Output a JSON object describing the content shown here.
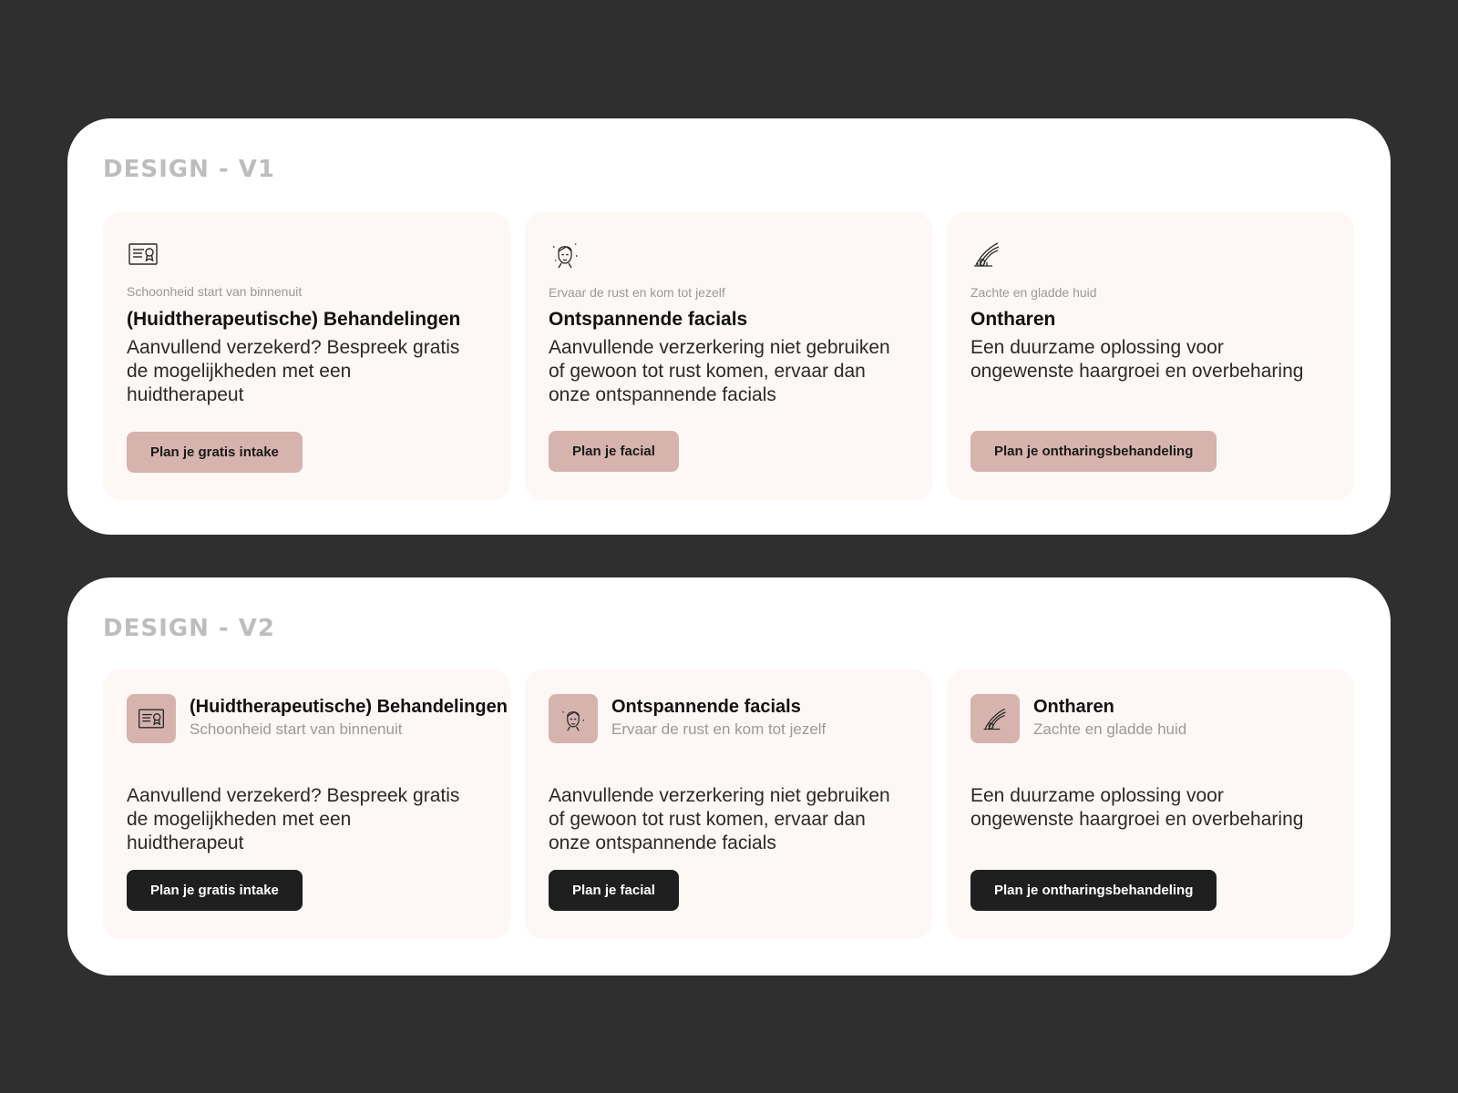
{
  "colors": {
    "background": "#2f2f2f",
    "panel": "#ffffff",
    "card": "#fdf7f5",
    "accent": "#d6b3ad",
    "dark_button": "#1f1f1f",
    "label_gray": "#bdbdbd"
  },
  "v1": {
    "label": "DESIGN - V1",
    "cards": [
      {
        "icon": "certificate-icon",
        "eyebrow": "Schoonheid start van binnenuit",
        "title": "(Huidtherapeutische) Behandelingen",
        "description": "Aanvullend verzekerd? Bespreek gratis de mogelijkheden met een huidtherapeut",
        "button": "Plan je gratis intake"
      },
      {
        "icon": "face-icon",
        "eyebrow": "Ervaar de rust en kom tot jezelf",
        "title": "Ontspannende facials",
        "description": "Aanvullende verzerkering niet gebruiken of gewoon tot rust komen, ervaar dan onze ontspannende facials",
        "button": "Plan je facial"
      },
      {
        "icon": "hair-follicle-icon",
        "eyebrow": "Zachte en gladde huid",
        "title": "Ontharen",
        "description": "Een duurzame oplossing voor ongewenste haargroei en overbeharing",
        "button": "Plan je ontharingsbehandeling"
      }
    ]
  },
  "v2": {
    "label": "DESIGN - V2",
    "cards": [
      {
        "icon": "certificate-icon",
        "title": "(Huidtherapeutische) Behandelingen",
        "subtitle": "Schoonheid start van binnenuit",
        "description": "Aanvullend verzekerd? Bespreek gratis de mogelijkheden met een huidtherapeut",
        "button": "Plan je gratis intake"
      },
      {
        "icon": "face-icon",
        "title": "Ontspannende facials",
        "subtitle": "Ervaar de rust en kom tot jezelf",
        "description": "Aanvullende verzerkering niet gebruiken of gewoon tot rust komen, ervaar dan onze ontspannende facials",
        "button": "Plan je facial"
      },
      {
        "icon": "hair-follicle-icon",
        "title": "Ontharen",
        "subtitle": "Zachte en gladde huid",
        "description": "Een duurzame oplossing voor ongewenste haargroei en overbeharing",
        "button": "Plan je ontharingsbehandeling"
      }
    ]
  }
}
